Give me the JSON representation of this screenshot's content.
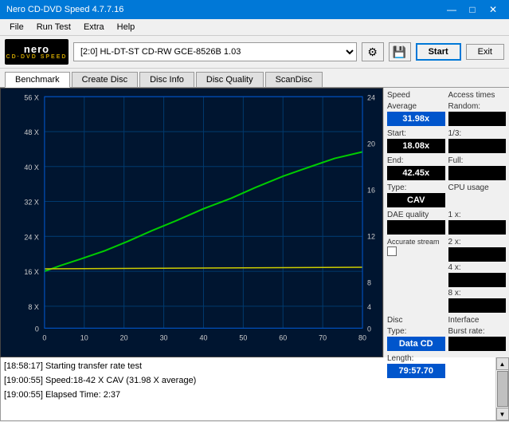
{
  "window": {
    "title": "Nero CD-DVD Speed 4.7.7.16",
    "controls": [
      "—",
      "□",
      "✕"
    ]
  },
  "menu": {
    "items": [
      "File",
      "Run Test",
      "Extra",
      "Help"
    ]
  },
  "toolbar": {
    "logo_top": "nero",
    "logo_bottom": "CD·DVD SPEED",
    "drive": "[2:0] HL-DT-ST CD-RW GCE-8526B 1.03",
    "start_label": "Start",
    "exit_label": "Exit"
  },
  "tabs": [
    {
      "label": "Benchmark",
      "active": true
    },
    {
      "label": "Create Disc",
      "active": false
    },
    {
      "label": "Disc Info",
      "active": false
    },
    {
      "label": "Disc Quality",
      "active": false
    },
    {
      "label": "ScanDisc",
      "active": false
    }
  ],
  "chart": {
    "y_left_labels": [
      "56 X",
      "48 X",
      "40 X",
      "32 X",
      "24 X",
      "16 X",
      "8 X",
      "0"
    ],
    "y_right_labels": [
      "24",
      "20",
      "16",
      "12",
      "8",
      "4",
      "0"
    ],
    "x_labels": [
      "0",
      "10",
      "20",
      "30",
      "40",
      "50",
      "60",
      "70",
      "80"
    ],
    "bg_color": "#001530",
    "grid_color": "#003366"
  },
  "right_panel": {
    "speed": {
      "section_label": "Speed",
      "average_label": "Average",
      "average_value": "31.98x",
      "start_label": "Start:",
      "start_value": "18.08x",
      "end_label": "End:",
      "end_value": "42.45x",
      "type_label": "Type:",
      "type_value": "CAV"
    },
    "access_times": {
      "section_label": "Access times",
      "random_label": "Random:",
      "random_value": "",
      "onethird_label": "1/3:",
      "onethird_value": "",
      "full_label": "Full:",
      "full_value": ""
    },
    "dae": {
      "section_label": "DAE quality",
      "dae_value": "",
      "accurate_label": "Accurate stream",
      "accurate_checked": false
    },
    "cpu": {
      "section_label": "CPU usage",
      "x1_label": "1 x:",
      "x1_value": "",
      "x2_label": "2 x:",
      "x2_value": "",
      "x4_label": "4 x:",
      "x4_value": "",
      "x8_label": "8 x:",
      "x8_value": ""
    },
    "disc": {
      "section_label": "Disc",
      "type_label": "Type:",
      "type_value": "Data CD",
      "length_label": "Length:",
      "length_value": "79:57.70"
    },
    "interface": {
      "section_label": "Interface",
      "burst_label": "Burst rate:",
      "burst_value": ""
    }
  },
  "log": {
    "lines": [
      "[18:58:17]  Starting transfer rate test",
      "[19:00:55]  Speed:18-42 X CAV (31.98 X average)",
      "[19:00:55]  Elapsed Time: 2:37"
    ]
  }
}
